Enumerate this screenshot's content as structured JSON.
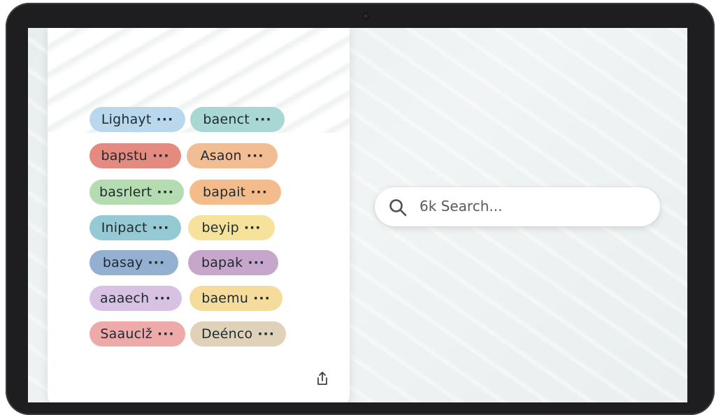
{
  "search": {
    "placeholder": "6k Search..."
  },
  "tags": [
    {
      "label": "Lighayt",
      "dots": "···",
      "color": "#b9d8ee"
    },
    {
      "label": "baenct",
      "dots": "···",
      "color": "#a9d7d4"
    },
    {
      "label": "bapstu",
      "dots": "···",
      "color": "#e58a7e"
    },
    {
      "label": "Asaon",
      "dots": "···",
      "color": "#f2bd93"
    },
    {
      "label": "basrlert",
      "dots": "···",
      "color": "#b5dcb0"
    },
    {
      "label": "bapait",
      "dots": "···",
      "color": "#f4bb8b"
    },
    {
      "label": "Inipact",
      "dots": "···",
      "color": "#95c9d3"
    },
    {
      "label": "beyip",
      "dots": "···",
      "color": "#f6e29a"
    },
    {
      "label": "basay",
      "dots": "···",
      "color": "#93b0d0"
    },
    {
      "label": "bapak",
      "dots": "···",
      "color": "#c7a6cc"
    },
    {
      "label": "aaaech",
      "dots": "···",
      "color": "#d7c2e3"
    },
    {
      "label": "baemu",
      "dots": "···",
      "color": "#f5dc9c"
    },
    {
      "label": "Saauclž",
      "dots": "···",
      "color": "#eeaaa8"
    },
    {
      "label": "Deénco",
      "dots": "···",
      "color": "#e0d2b8"
    }
  ]
}
